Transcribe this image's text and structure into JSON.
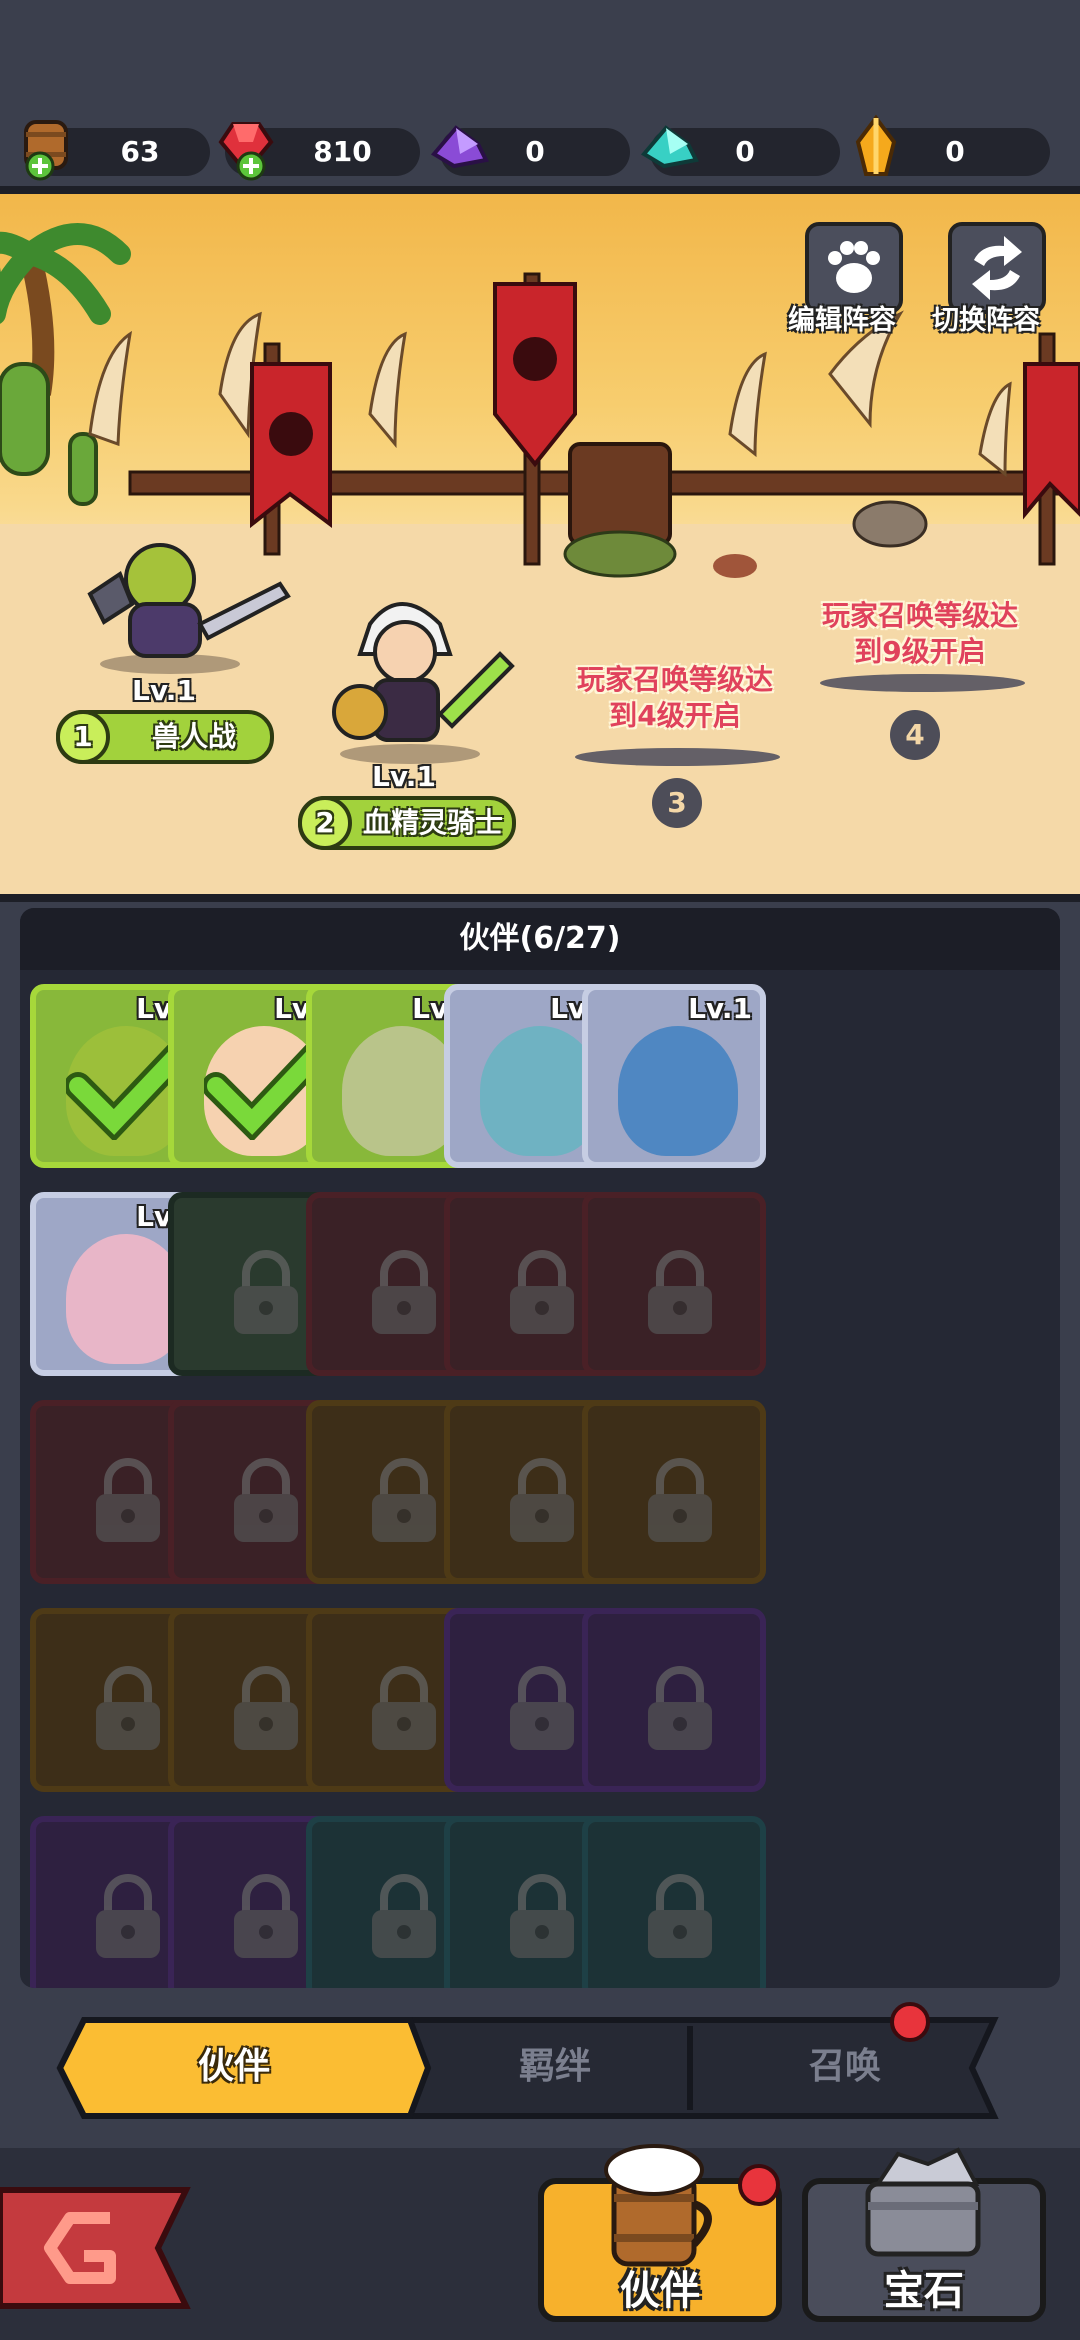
{
  "resources": [
    {
      "icon": "barrel-plus-icon",
      "value": "63"
    },
    {
      "icon": "ruby-plus-icon",
      "value": "810"
    },
    {
      "icon": "purple-crystal-icon",
      "value": "0"
    },
    {
      "icon": "cyan-crystal-icon",
      "value": "0"
    },
    {
      "icon": "amber-gem-icon",
      "value": "0"
    }
  ],
  "scene": {
    "edit_label": "编辑阵容",
    "switch_label": "切换阵容",
    "heroes": [
      {
        "slot": "1",
        "name": "兽人战",
        "level": "Lv.1"
      },
      {
        "slot": "2",
        "name": "血精灵骑士",
        "level": "Lv.1"
      }
    ],
    "locked_slots": [
      {
        "slot": "3",
        "text_line1": "玩家召唤等级达",
        "text_line2": "到4级开启"
      },
      {
        "slot": "4",
        "text_line1": "玩家召唤等级达",
        "text_line2": "到9级开启"
      }
    ]
  },
  "panel": {
    "title": "伙伴(6/27)",
    "unlocked_level": "Lv.1"
  },
  "tabs": {
    "partner": "伙伴",
    "bond": "羁绊",
    "summon": "召唤"
  },
  "nav": {
    "partner": "伙伴",
    "gem": "宝石"
  },
  "colors": {
    "accent": "#f7b12c",
    "selected_frame": "#a6d83a",
    "tab_active": "#fbbd33"
  }
}
